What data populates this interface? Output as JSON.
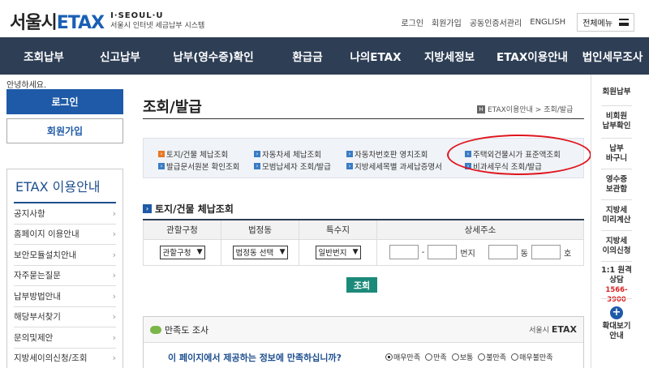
{
  "header": {
    "logo_main": "서울시",
    "logo_etax": "ETAX",
    "logo_sub_top": "I·SEOUL·U",
    "logo_sub_bottom": "서울시 인터넷 세금납부 시스템",
    "util_links": [
      "로그인",
      "회원가입",
      "공동인증서관리",
      "ENGLISH"
    ],
    "all_menu": "전체메뉴"
  },
  "nav": {
    "items": [
      "조회납부",
      "신고납부",
      "납부(영수증)확인",
      "환급금",
      "나의ETAX",
      "지방세정보",
      "ETAX이용안내",
      "법인세무조사"
    ]
  },
  "sidebar": {
    "greeting": "안녕하세요.",
    "login_label": "로그인",
    "join_label": "회원가입",
    "lnb_title": "ETAX 이용안내",
    "items": [
      "공지사항",
      "홈페이지 이용안내",
      "보안모듈설치안내",
      "자주묻는질문",
      "납부방법안내",
      "해당부서찾기",
      "문의및제안",
      "지방세이의신청/조회"
    ]
  },
  "main": {
    "title": "조회/발급",
    "breadcrumb_home": "H",
    "breadcrumb": "ETAX이용안내 > 조회/발급",
    "links_row1": [
      "토지/건물 체납조회",
      "자동차세 체납조회",
      "자동차번호판 영치조회",
      "주택외건물시가 표준액조회"
    ],
    "links_row2": [
      "발급문서원본 확인조회",
      "모범납세자 조회/발급",
      "지방세세목별 과세납증명서",
      "비과세무식 조회/발급"
    ],
    "section_title": "토지/건물 체납조회",
    "table": {
      "headers": [
        "관할구청",
        "법정동",
        "특수지",
        "상세주소"
      ],
      "select_gu": "관할구청",
      "select_dong": "법정동 선택",
      "select_special": "일반번지",
      "dash": "-",
      "label_beonji": "번지",
      "label_dong": "동",
      "label_ho": "호"
    },
    "search_label": "조회"
  },
  "survey": {
    "title": "만족도 조사",
    "brand_small": "서울시",
    "brand": "ETAX",
    "question": "이 페이지에서 제공하는 정보에 만족하십니까?",
    "options": [
      "매우만족",
      "만족",
      "보통",
      "불만족",
      "매우불만족"
    ],
    "selected_index": 0
  },
  "quick": {
    "items": [
      "회원납부",
      "비회원\n납부확인",
      "납부\n바구니",
      "영수증\n보관함",
      "지방세\n미리계산",
      "지방세\n이의신청",
      "1:1 원격\n상담"
    ],
    "phone": "1566-3900",
    "zoom_label": "확대보기\n안내"
  },
  "colors": {
    "nav_bg": "#2d3e55",
    "brand_blue": "#1e5aa8",
    "search_button": "#1c8a7a",
    "highlight_oval": "#e0141e"
  }
}
